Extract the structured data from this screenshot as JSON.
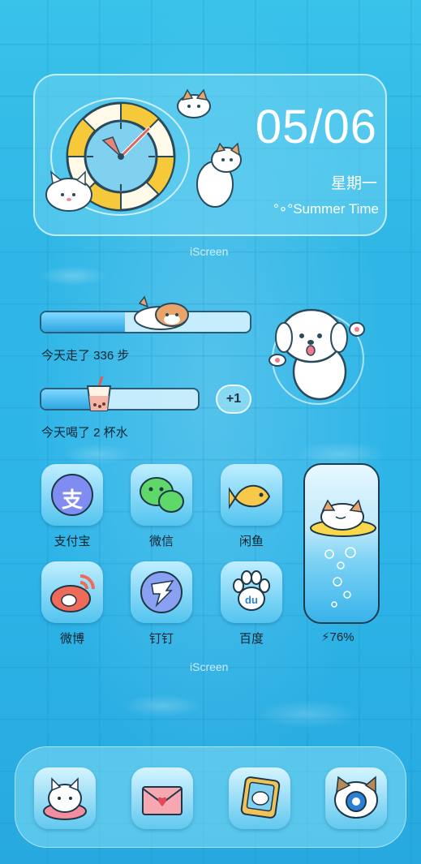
{
  "widget": {
    "date": "05/06",
    "weekday": "星期一",
    "subtitle": "°∘°Summer Time"
  },
  "watermark": "iScreen",
  "steps": {
    "label": "今天走了 336 步",
    "progress": 0.4
  },
  "water": {
    "label": "今天喝了 2 杯水",
    "progress": 0.38,
    "plus_label": "+1"
  },
  "apps": [
    {
      "label": "支付宝",
      "icon": "alipay-icon"
    },
    {
      "label": "微信",
      "icon": "wechat-icon"
    },
    {
      "label": "闲鱼",
      "icon": "fish-icon"
    },
    {
      "label": "微博",
      "icon": "weibo-icon"
    },
    {
      "label": "钉钉",
      "icon": "dingtalk-icon"
    },
    {
      "label": "百度",
      "icon": "baidu-icon"
    }
  ],
  "battery": {
    "label": "76%",
    "level": 0.76
  },
  "dock": [
    {
      "icon": "cat-float-icon"
    },
    {
      "icon": "love-letter-icon"
    },
    {
      "icon": "photo-frame-icon"
    },
    {
      "icon": "dog-camera-icon"
    }
  ],
  "colors": {
    "water": "#2eb5e8",
    "accent": "#ffffff",
    "text": "#10232e"
  }
}
